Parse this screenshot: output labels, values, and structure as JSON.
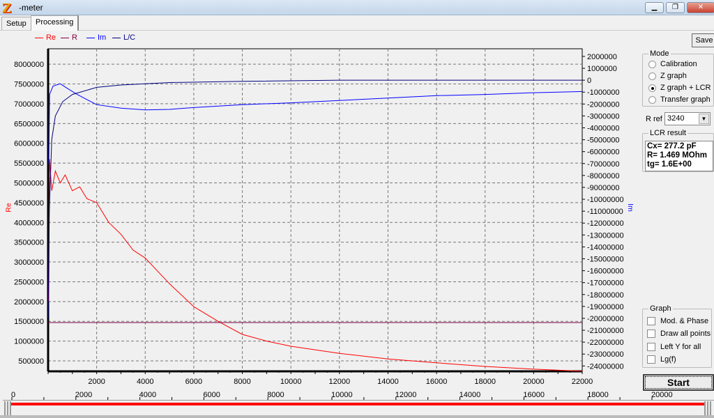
{
  "window": {
    "title": "-meter",
    "minimize": "▁",
    "maximize": "❐",
    "close": "✕"
  },
  "tabs": [
    {
      "label": "Setup"
    },
    {
      "label": "Processing"
    }
  ],
  "save_label": "Save",
  "mode": {
    "title": "Mode",
    "options": [
      {
        "label": "Calibration",
        "checked": false
      },
      {
        "label": "Z graph",
        "checked": false
      },
      {
        "label": "Z graph + LCR",
        "checked": true
      },
      {
        "label": "Transfer graph",
        "checked": false
      }
    ]
  },
  "rref": {
    "label": "R ref",
    "value": "3240"
  },
  "lcr": {
    "title": "LCR result",
    "lines": [
      "Cx= 277.2 pF",
      "R= 1.469 MOhm",
      "tg= 1.6E+00"
    ]
  },
  "graph": {
    "title": "Graph",
    "options": [
      {
        "label": "Mod. & Phase",
        "checked": false
      },
      {
        "label": "Draw all points",
        "checked": false
      },
      {
        "label": "Left Y for all",
        "checked": false
      },
      {
        "label": "Lg(f)",
        "checked": false
      }
    ]
  },
  "start_label": "Start",
  "slider": {
    "ticks": [
      "0",
      "2000",
      "4000",
      "6000",
      "8000",
      "10000",
      "12000",
      "14000",
      "16000",
      "18000",
      "20000"
    ],
    "range": [
      0,
      20000
    ],
    "value_from": 0,
    "value_to": 20000
  },
  "chart_data": {
    "type": "line",
    "xlabel": "",
    "ylabel_left": "Re",
    "ylabel_right": "Im",
    "xlim": [
      0,
      22000
    ],
    "ylim_left": [
      236000,
      8390000
    ],
    "ylim_right": [
      -24450000,
      2640000
    ],
    "x_ticks": [
      "2000",
      "4000",
      "6000",
      "8000",
      "10000",
      "12000",
      "14000",
      "16000",
      "18000",
      "20000",
      "22000"
    ],
    "left_ticks": [
      "8000000",
      "7500000",
      "7000000",
      "6500000",
      "6000000",
      "5500000",
      "5000000",
      "4500000",
      "4000000",
      "3500000",
      "3000000",
      "2500000",
      "2000000",
      "1500000",
      "1000000",
      "500000"
    ],
    "right_ticks": [
      "2000000",
      "1000000",
      "0",
      "-1000000",
      "-2000000",
      "-3000000",
      "-4000000",
      "-5000000",
      "-6000000",
      "-7000000",
      "-8000000",
      "-9000000",
      "-10000000",
      "-11000000",
      "-12000000",
      "-13000000",
      "-14000000",
      "-15000000",
      "-16000000",
      "-17000000",
      "-18000000",
      "-19000000",
      "-20000000",
      "-21000000",
      "-22000000",
      "-23000000",
      "-24000000"
    ],
    "legend": [
      {
        "name": "Re",
        "color": "#ff0000"
      },
      {
        "name": "R",
        "color": "#800040"
      },
      {
        "name": "Im",
        "color": "#0000ff"
      },
      {
        "name": "L/C",
        "color": "#000080"
      }
    ],
    "grid": true,
    "series": [
      {
        "name": "Re",
        "axis": "left",
        "color": "#ff0000",
        "points": [
          [
            30,
            2000000
          ],
          [
            60,
            5600000
          ],
          [
            150,
            4800000
          ],
          [
            300,
            5300000
          ],
          [
            500,
            5000000
          ],
          [
            700,
            5200000
          ],
          [
            1000,
            4800000
          ],
          [
            1300,
            4900000
          ],
          [
            1600,
            4600000
          ],
          [
            2000,
            4500000
          ],
          [
            2500,
            4000000
          ],
          [
            3000,
            3700000
          ],
          [
            3500,
            3300000
          ],
          [
            4000,
            3100000
          ],
          [
            5000,
            2450000
          ],
          [
            6000,
            1870000
          ],
          [
            7000,
            1500000
          ],
          [
            8000,
            1170000
          ],
          [
            9000,
            1000000
          ],
          [
            10000,
            870000
          ],
          [
            12000,
            690000
          ],
          [
            14000,
            550000
          ],
          [
            16000,
            450000
          ],
          [
            18000,
            360000
          ],
          [
            20000,
            290000
          ],
          [
            22000,
            240000
          ]
        ]
      },
      {
        "name": "R",
        "axis": "left",
        "color": "#800040",
        "points": [
          [
            0,
            1469000
          ],
          [
            22000,
            1469000
          ]
        ]
      },
      {
        "name": "Im",
        "axis": "right",
        "color": "#0000ff",
        "points": [
          [
            30,
            -7000000
          ],
          [
            60,
            -1200000
          ],
          [
            200,
            -500000
          ],
          [
            500,
            -300000
          ],
          [
            800,
            -700000
          ],
          [
            1200,
            -1200000
          ],
          [
            2000,
            -2050000
          ],
          [
            3000,
            -2350000
          ],
          [
            4000,
            -2500000
          ],
          [
            5000,
            -2450000
          ],
          [
            6000,
            -2300000
          ],
          [
            8000,
            -2050000
          ],
          [
            10000,
            -1900000
          ],
          [
            12000,
            -1700000
          ],
          [
            14000,
            -1500000
          ],
          [
            16000,
            -1300000
          ],
          [
            18000,
            -1200000
          ],
          [
            20000,
            -1050000
          ],
          [
            22000,
            -950000
          ]
        ]
      },
      {
        "name": "L/C",
        "axis": "right",
        "color": "#000080",
        "points": [
          [
            0,
            -20000000
          ],
          [
            50,
            -11000000
          ],
          [
            150,
            -5000000
          ],
          [
            300,
            -3000000
          ],
          [
            600,
            -1800000
          ],
          [
            1000,
            -1200000
          ],
          [
            2000,
            -600000
          ],
          [
            3000,
            -400000
          ],
          [
            5000,
            -200000
          ],
          [
            8000,
            -100000
          ],
          [
            12000,
            0
          ],
          [
            22000,
            0
          ]
        ]
      }
    ]
  }
}
